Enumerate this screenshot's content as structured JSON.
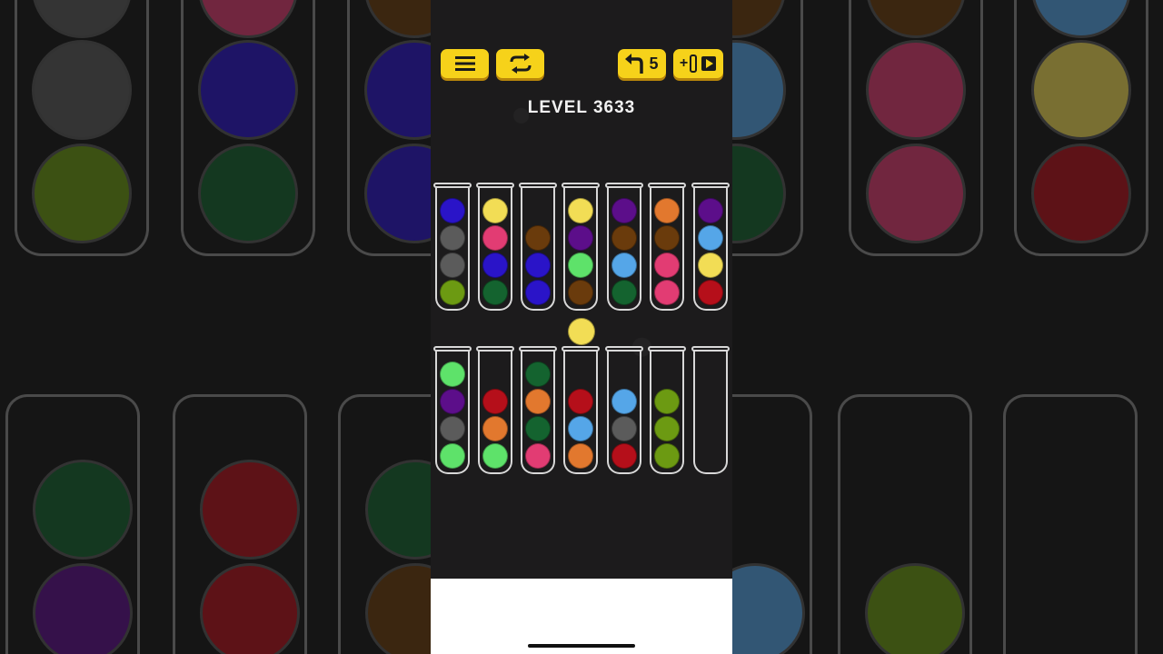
{
  "level": {
    "label": "LEVEL 3633"
  },
  "toolbar": {
    "menu_icon": "menu-icon",
    "restart_icon": "restart-icon",
    "undo_icon": "undo-icon",
    "undo_count": "5",
    "add_tube_label": "+",
    "video_icon": "video-play-icon"
  },
  "colors": {
    "blue": "#2a14c8",
    "gray": "#5b5b5b",
    "olive": "#6c9a12",
    "yellow": "#f2dd55",
    "pink": "#e23c73",
    "green": "#14632f",
    "brown": "#6a3b0c",
    "purple": "#5c0e8a",
    "lime": "#5ee26a",
    "orange": "#e2782e",
    "skyblue": "#55a6e8",
    "red": "#b50f1a"
  },
  "lifted_ball": "yellow",
  "tubes_top": [
    [
      "blue",
      "gray",
      "gray",
      "olive"
    ],
    [
      "yellow",
      "pink",
      "blue",
      "green"
    ],
    [
      "brown",
      "blue",
      "blue"
    ],
    [
      "yellow",
      "purple",
      "lime",
      "brown"
    ],
    [
      "purple",
      "brown",
      "skyblue",
      "green"
    ],
    [
      "orange",
      "brown",
      "pink",
      "pink"
    ],
    [
      "purple",
      "skyblue",
      "yellow",
      "red"
    ]
  ],
  "tubes_bottom": [
    [
      "lime",
      "purple",
      "gray",
      "lime"
    ],
    [
      "red",
      "orange",
      "lime"
    ],
    [
      "green",
      "orange",
      "green",
      "pink"
    ],
    [
      "red",
      "skyblue",
      "orange"
    ],
    [
      "skyblue",
      "gray",
      "red"
    ],
    [
      "olive",
      "olive",
      "olive"
    ],
    []
  ]
}
